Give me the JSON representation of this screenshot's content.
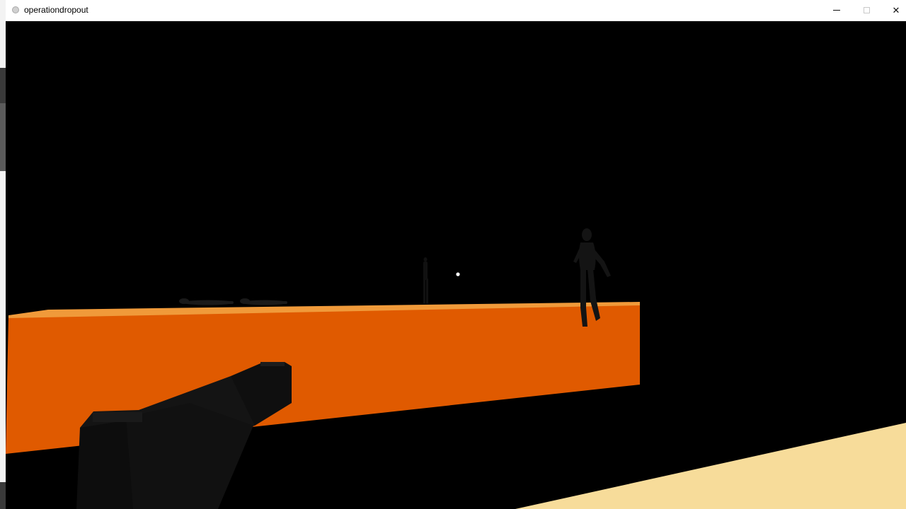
{
  "window": {
    "title": "operationdropout",
    "icon": "app-icon",
    "controls": [
      "minimize-icon",
      "maximize-icon",
      "close-icon"
    ],
    "close_glyph": "✕"
  },
  "scene": {
    "type": "3d-game-view",
    "sky_color": "#000000",
    "platform_color": "#e05a00",
    "platform_top_color": "#f08a2a",
    "ground_light_color": "#f7dc9a",
    "weapon_color": "#121212",
    "crosshair_color": "#ffffff",
    "elements": [
      "orange-platform",
      "standing-figure-near",
      "standing-figure-far",
      "prone-figure-1",
      "prone-figure-2",
      "first-person-weapon",
      "crosshair",
      "lit-ground-patch"
    ]
  }
}
